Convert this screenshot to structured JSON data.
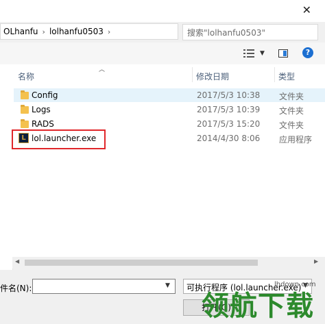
{
  "titlebar": {
    "close_glyph": "✕"
  },
  "address": {
    "crumbs": [
      "OLhanfu",
      "lolhanfu0503"
    ],
    "separator": "›"
  },
  "search": {
    "placeholder": "搜索\"lolhanfu0503\""
  },
  "toolbar": {
    "help_glyph": "?"
  },
  "columns": {
    "name": "名称",
    "date": "修改日期",
    "type": "类型"
  },
  "files": [
    {
      "name": "Config",
      "date": "2017/5/3 10:38",
      "type": "文件夹",
      "icon": "folder-icon",
      "selected": true
    },
    {
      "name": "Logs",
      "date": "2017/5/3 10:39",
      "type": "文件夹",
      "icon": "folder-icon"
    },
    {
      "name": "RADS",
      "date": "2017/5/3 15:20",
      "type": "文件夹",
      "icon": "folder-icon"
    },
    {
      "name": "lol.launcher.exe",
      "date": "2014/4/30 8:06",
      "type": "应用程序",
      "icon": "lol-launcher-icon",
      "highlighted": true
    }
  ],
  "footer": {
    "filename_label": "件名(N):",
    "filename_value": "",
    "filetype_value": "可执行程序 (lol.launcher.exe)",
    "open_label": "打开(O)"
  },
  "watermark": {
    "text": "领航下载",
    "site": "lhdown.com"
  }
}
